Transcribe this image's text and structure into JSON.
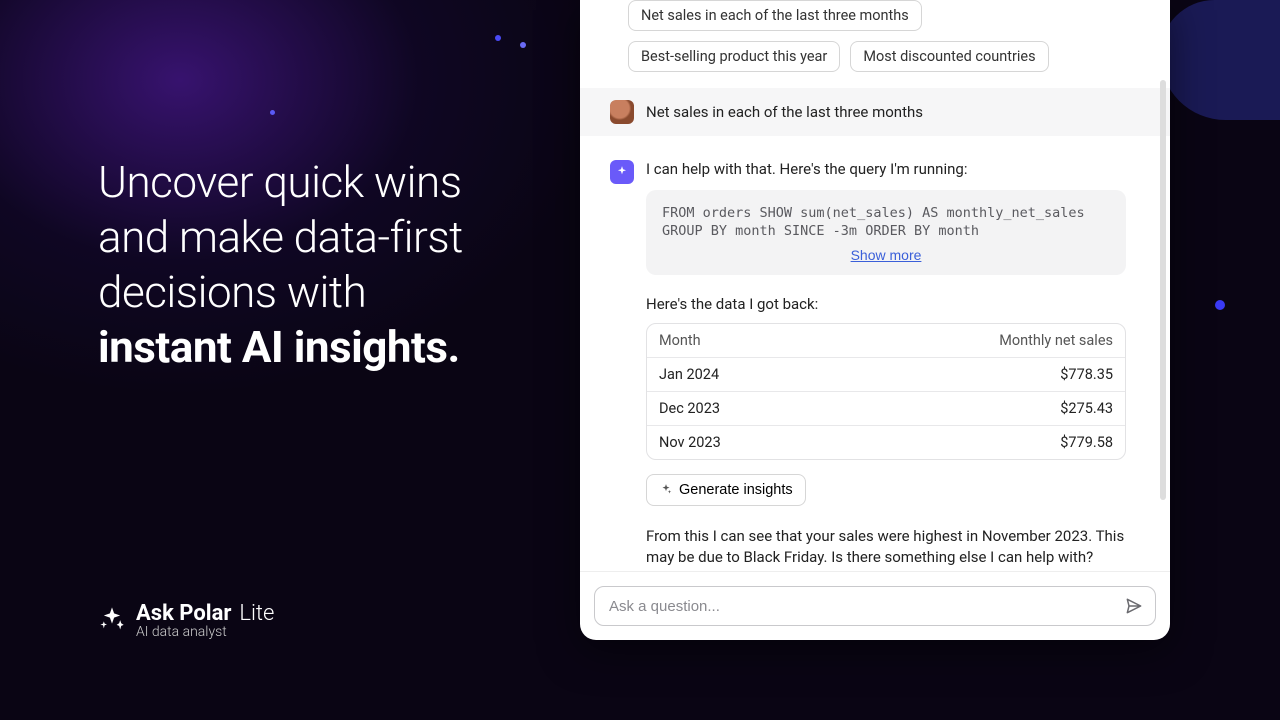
{
  "headline": {
    "line1": "Uncover quick wins",
    "line2": "and make data-first",
    "line3": "decisions with",
    "bold": "instant AI insights."
  },
  "brand": {
    "name": "Ask Polar",
    "suffix": "Lite",
    "tagline": "AI data analyst"
  },
  "chips": {
    "0": "Net sales in each of the last three months",
    "1": "Best-selling product this year",
    "2": "Most discounted countries"
  },
  "user_message": "Net sales in each of the last three months",
  "ai_intro": "I can help with that. Here's the query I'm running:",
  "query": "FROM orders SHOW sum(net_sales) AS monthly_net_sales GROUP BY month SINCE -3m ORDER BY month",
  "show_more": "Show more",
  "data_label": "Here's the data I got back:",
  "table": {
    "h1": "Month",
    "h2": "Monthly net sales",
    "rows": [
      {
        "month": "Jan 2024",
        "value": "$778.35"
      },
      {
        "month": "Dec 2023",
        "value": "$275.43"
      },
      {
        "month": "Nov 2023",
        "value": "$779.58"
      }
    ]
  },
  "generate_label": "Generate insights",
  "summary": "From this I can see that your sales were highest in November 2023. This may be due to Black Friday. Is there something else I can help with?",
  "input_placeholder": "Ask a question..."
}
